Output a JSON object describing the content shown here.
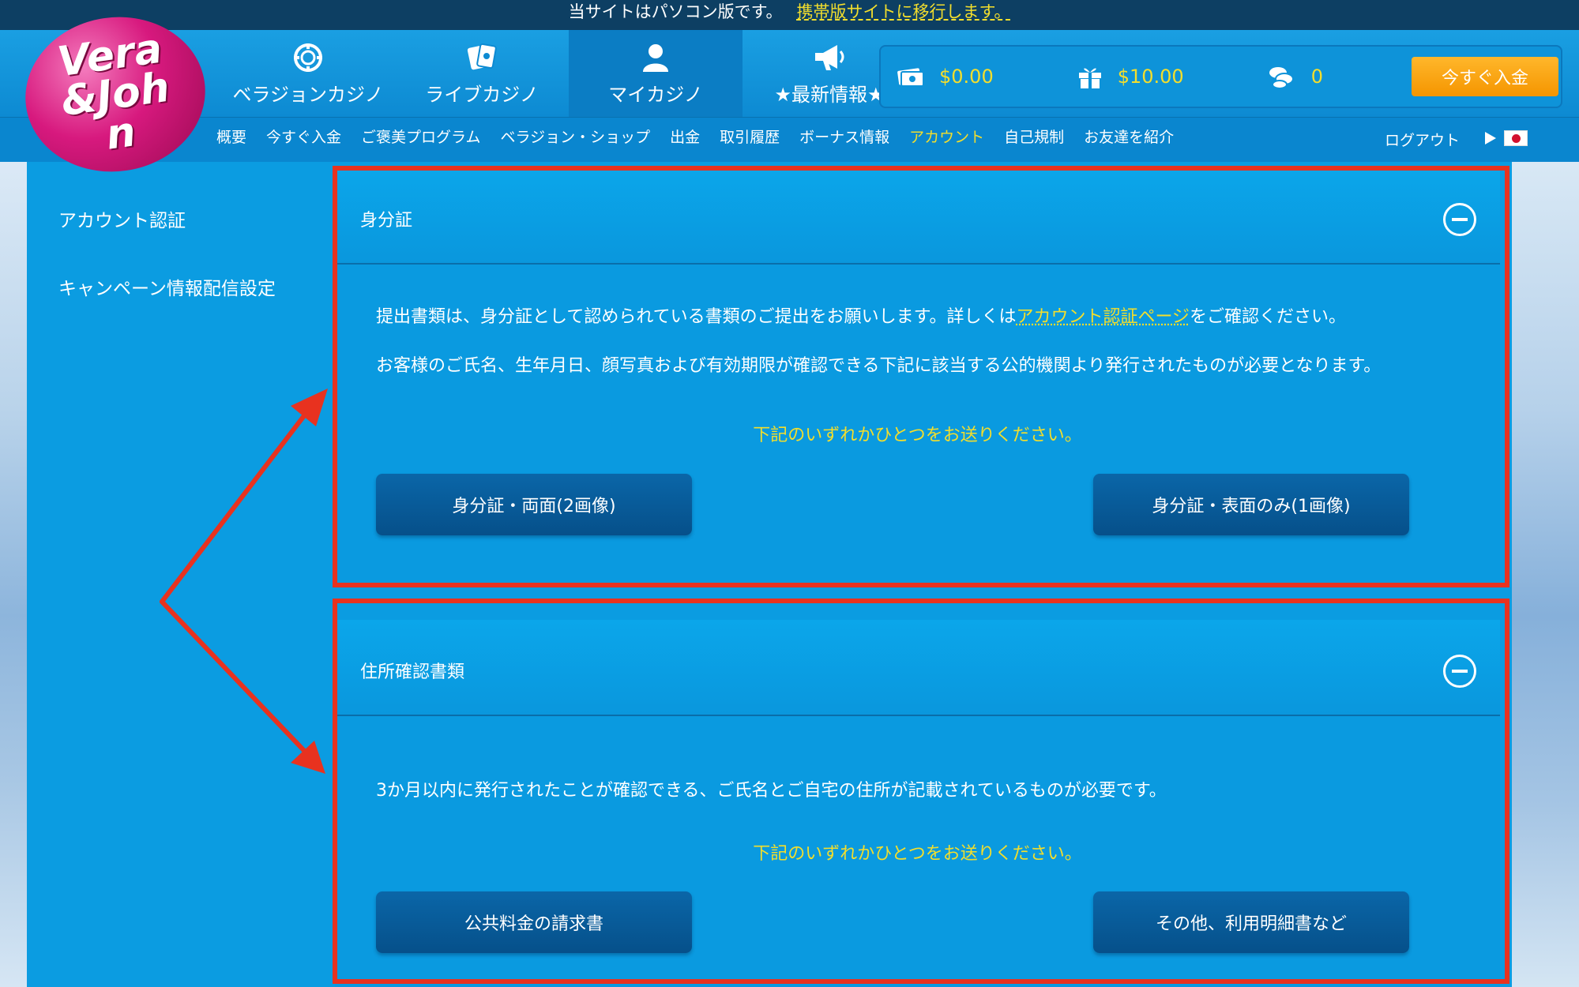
{
  "notice": {
    "text": "当サイトはパソコン版です。",
    "link": "携帯版サイトに移行します。"
  },
  "logo": {
    "text": "Vera&John"
  },
  "main_nav": [
    {
      "label": "ベラジョンカジノ",
      "icon": "chip-icon"
    },
    {
      "label": "ライブカジノ",
      "icon": "cards-icon"
    },
    {
      "label": "マイカジノ",
      "icon": "user-icon"
    },
    {
      "label": "★最新情報★",
      "icon": "megaphone-icon"
    }
  ],
  "wallet": {
    "cash": "$0.00",
    "bonus": "$10.00",
    "points": "0",
    "deposit_label": "今すぐ入金"
  },
  "sub_nav": {
    "links": [
      "概要",
      "今すぐ入金",
      "ご褒美プログラム",
      "ベラジョン・ショップ",
      "出金",
      "取引履歴",
      "ボーナス情報",
      "アカウント",
      "自己規制",
      "お友達を紹介"
    ],
    "active": "アカウント",
    "logout": "ログアウト"
  },
  "sidebar": {
    "items": [
      "アカウント認証",
      "キャンペーン情報配信設定"
    ]
  },
  "sections": {
    "id": {
      "title": "身分証",
      "para1_pre": "提出書類は、身分証として認められている書類のご提出をお願いします。詳しくは",
      "para1_link": "アカウント認証ページ",
      "para1_post": "をご確認ください。",
      "para2": "お客様のご氏名、生年月日、顔写真および有効期限が確認できる下記に該当する公的機関より発行されたものが必要となります。",
      "note": "下記のいずれかひとつをお送りください。",
      "btn1": "身分証・両面(2画像)",
      "btn2": "身分証・表面のみ(1画像)"
    },
    "address": {
      "title": "住所確認書類",
      "para1": "3か月以内に発行されたことが確認できる、ご氏名とご自宅の住所が記載されているものが必要です。",
      "note": "下記のいずれかひとつをお送りください。",
      "btn1": "公共料金の請求書",
      "btn2": "その他、利用明細書など"
    }
  },
  "colors": {
    "accent_yellow": "#f3de2c",
    "annotation_red": "#e8321f",
    "primary_blue": "#0b9ce1"
  }
}
